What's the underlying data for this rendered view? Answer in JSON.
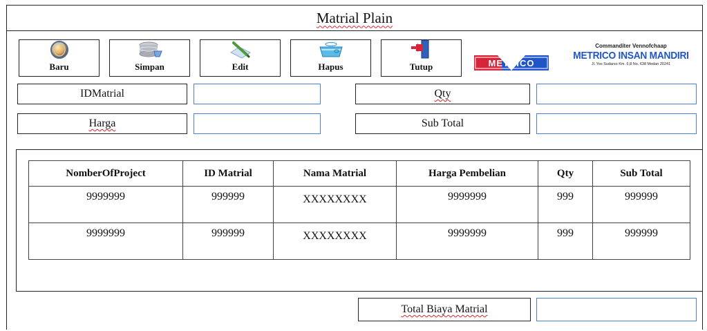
{
  "window": {
    "title": "Matrial Plain"
  },
  "toolbar": {
    "buttons": [
      {
        "label": "Baru",
        "icon": "new-icon"
      },
      {
        "label": "Simpan",
        "icon": "save-icon"
      },
      {
        "label": "Edit",
        "icon": "edit-icon"
      },
      {
        "label": "Hapus",
        "icon": "delete-icon"
      },
      {
        "label": "Tutup",
        "icon": "exit-icon"
      }
    ]
  },
  "brand": {
    "logo_text": "METRICO",
    "tagline": "Commanditer Vennofchaap",
    "company_name": "METRICO INSAN MANDIRI",
    "address": "Jl. Yos Sudarso Km. 6,8 No. 638 Medan 20241",
    "colors": {
      "logo_red": "#d8243a",
      "logo_blue": "#1f55c8"
    }
  },
  "form": {
    "id_label": "IDMatrial",
    "id_value": "",
    "harga_label": "Harga",
    "harga_value": "",
    "qty_label": "Qty",
    "qty_value": "",
    "subtotal_label": "Sub Total",
    "subtotal_value": ""
  },
  "table": {
    "headers": [
      "NomberOfProject",
      "ID Matrial",
      "Nama Matrial",
      "Harga Pembelian",
      "Qty",
      "Sub Total"
    ],
    "rows": [
      [
        "9999999",
        "999999",
        "XXXXXXXX",
        "9999999",
        "999",
        "999999"
      ],
      [
        "9999999",
        "999999",
        "XXXXXXXX",
        "9999999",
        "999",
        "999999"
      ]
    ]
  },
  "footer": {
    "total_label": "Total Biaya Matrial",
    "total_value": ""
  }
}
